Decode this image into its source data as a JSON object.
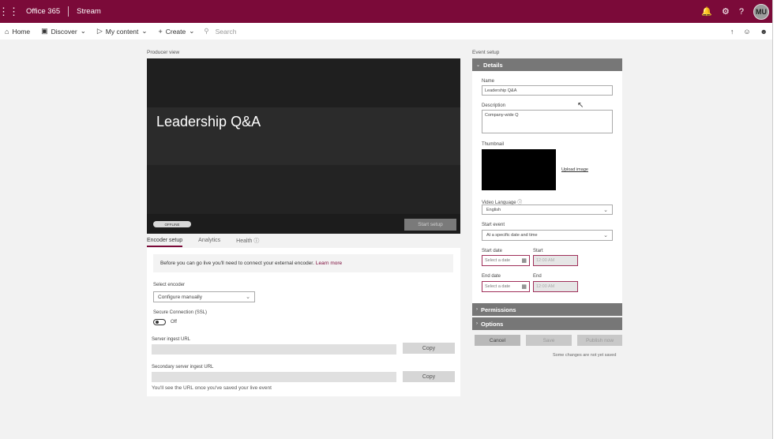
{
  "topbar": {
    "brand": "Office 365",
    "app": "Stream",
    "avatar_initials": "MU",
    "icons": [
      "bell-icon",
      "gear-icon",
      "help-icon"
    ]
  },
  "nav": {
    "home": "Home",
    "discover": "Discover",
    "my_content": "My content",
    "create": "Create",
    "search_placeholder": "Search"
  },
  "producer": {
    "label": "Producer view",
    "video_title": "Leadership Q&A",
    "status_badge": "OFFLINE",
    "start_setup": "Start setup"
  },
  "tabs": [
    "Encoder setup",
    "Analytics",
    "Health ⓘ"
  ],
  "encoder": {
    "info_text": "Before you can go live you'll need to connect your external encoder.",
    "learn_more": "Learn more",
    "select_encoder_label": "Select encoder",
    "select_encoder_value": "Configure manually",
    "secure_label": "Secure Connection (SSL)",
    "secure_state": "Off",
    "server_url_label": "Server ingest URL",
    "secondary_url_label": "Secondary server ingest URL",
    "copy": "Copy",
    "footer_note": "You'll see the URL once you've saved your live event"
  },
  "event": {
    "label": "Event setup",
    "details": "Details",
    "name_label": "Name",
    "name_value": "Leadership Q&A",
    "description_label": "Description",
    "description_value": "Company-wide Q",
    "thumbnail_label": "Thumbnail",
    "upload_image": "Upload image",
    "language_label": "Video Language ⓘ",
    "language_value": "English",
    "start_event_label": "Start event",
    "start_event_value": "At a specific date and time",
    "start_date_label": "Start date",
    "start_label": "Start",
    "end_date_label": "End date",
    "end_label": "End",
    "date_placeholder": "Select a date",
    "time_placeholder": "12:00 AM",
    "permissions": "Permissions",
    "options": "Options",
    "cancel": "Cancel",
    "save": "Save",
    "publish": "Publish now",
    "unsaved_note": "Some changes are not yet saved"
  },
  "colors": {
    "brand": "#7b0a39",
    "accordion": "#777777"
  }
}
